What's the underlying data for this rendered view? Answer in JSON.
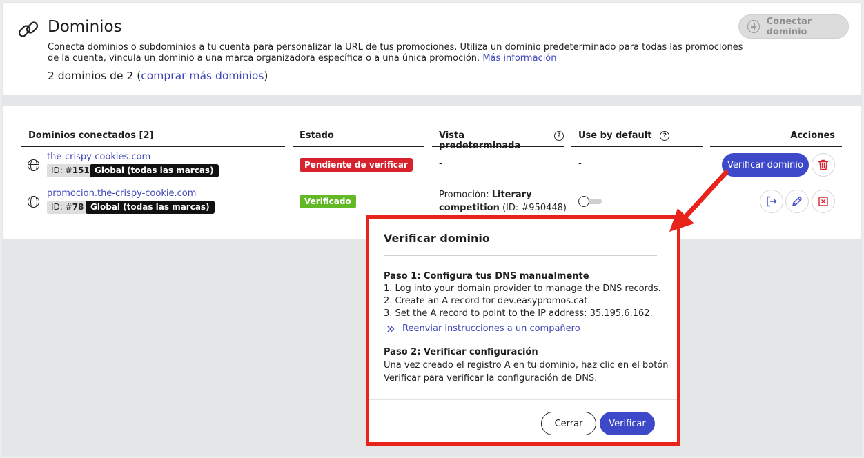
{
  "header": {
    "title": "Dominios",
    "description": "Conecta dominios o subdominios a tu cuenta para personalizar la URL de tus promociones. Utiliza un dominio predeterminado para todas las promociones de la cuenta, vincula un dominio a una marca organizadora específica o a una única promoción.",
    "more_info_link": "Más información",
    "count_prefix": "2 dominios de 2 (",
    "buy_more_link": "comprar más dominios",
    "count_suffix": ")",
    "connect_button": "Conectar dominio"
  },
  "table": {
    "columns": {
      "domains": "Dominios conectados [2]",
      "status": "Estado",
      "default_view": "Vista predeterminada",
      "use_by_default": "Use by default",
      "actions": "Acciones"
    },
    "rows": [
      {
        "domain": "the-crispy-cookies.com",
        "id_label": "ID: #",
        "id_value": "151",
        "brand": "Global (todas las marcas)",
        "status": "Pendiente de verificar",
        "status_color": "#d8232f",
        "default_view": "-",
        "use_by_default": "-",
        "action_button": "Verificar dominio"
      },
      {
        "domain": "promocion.the-crispy-cookie.com",
        "id_label": "ID: #",
        "id_value": "78",
        "brand": "Global (todas las marcas)",
        "status": "Verificado",
        "status_color": "#63b826",
        "default_view_prefix": "Promoción: ",
        "default_view_name_1": "Literary",
        "default_view_name_2": "competition",
        "default_view_id": " (ID: #950448)",
        "use_by_default_on": false
      }
    ]
  },
  "modal": {
    "title": "Verificar dominio",
    "step1_title": "Paso 1: Configura tus DNS manualmente",
    "step1_lines": [
      "1. Log into your domain provider to manage the DNS records.",
      "2. Create an A record for dev.easypromos.cat.",
      "3. Set the A record to point to the IP address: 35.195.6.162."
    ],
    "forward_link": "Reenviar instrucciones a un compañero",
    "step2_title": "Paso 2: Verificar configuración",
    "step2_lines": [
      "Una vez creado el registro A en tu dominio, haz clic en el botón",
      "Verificar para verificar la configuración de DNS."
    ],
    "close_button": "Cerrar",
    "confirm_button": "Verificar"
  },
  "colors": {
    "accent": "#3d49c8",
    "link": "#3f47b8",
    "annotation": "#e8231c"
  }
}
